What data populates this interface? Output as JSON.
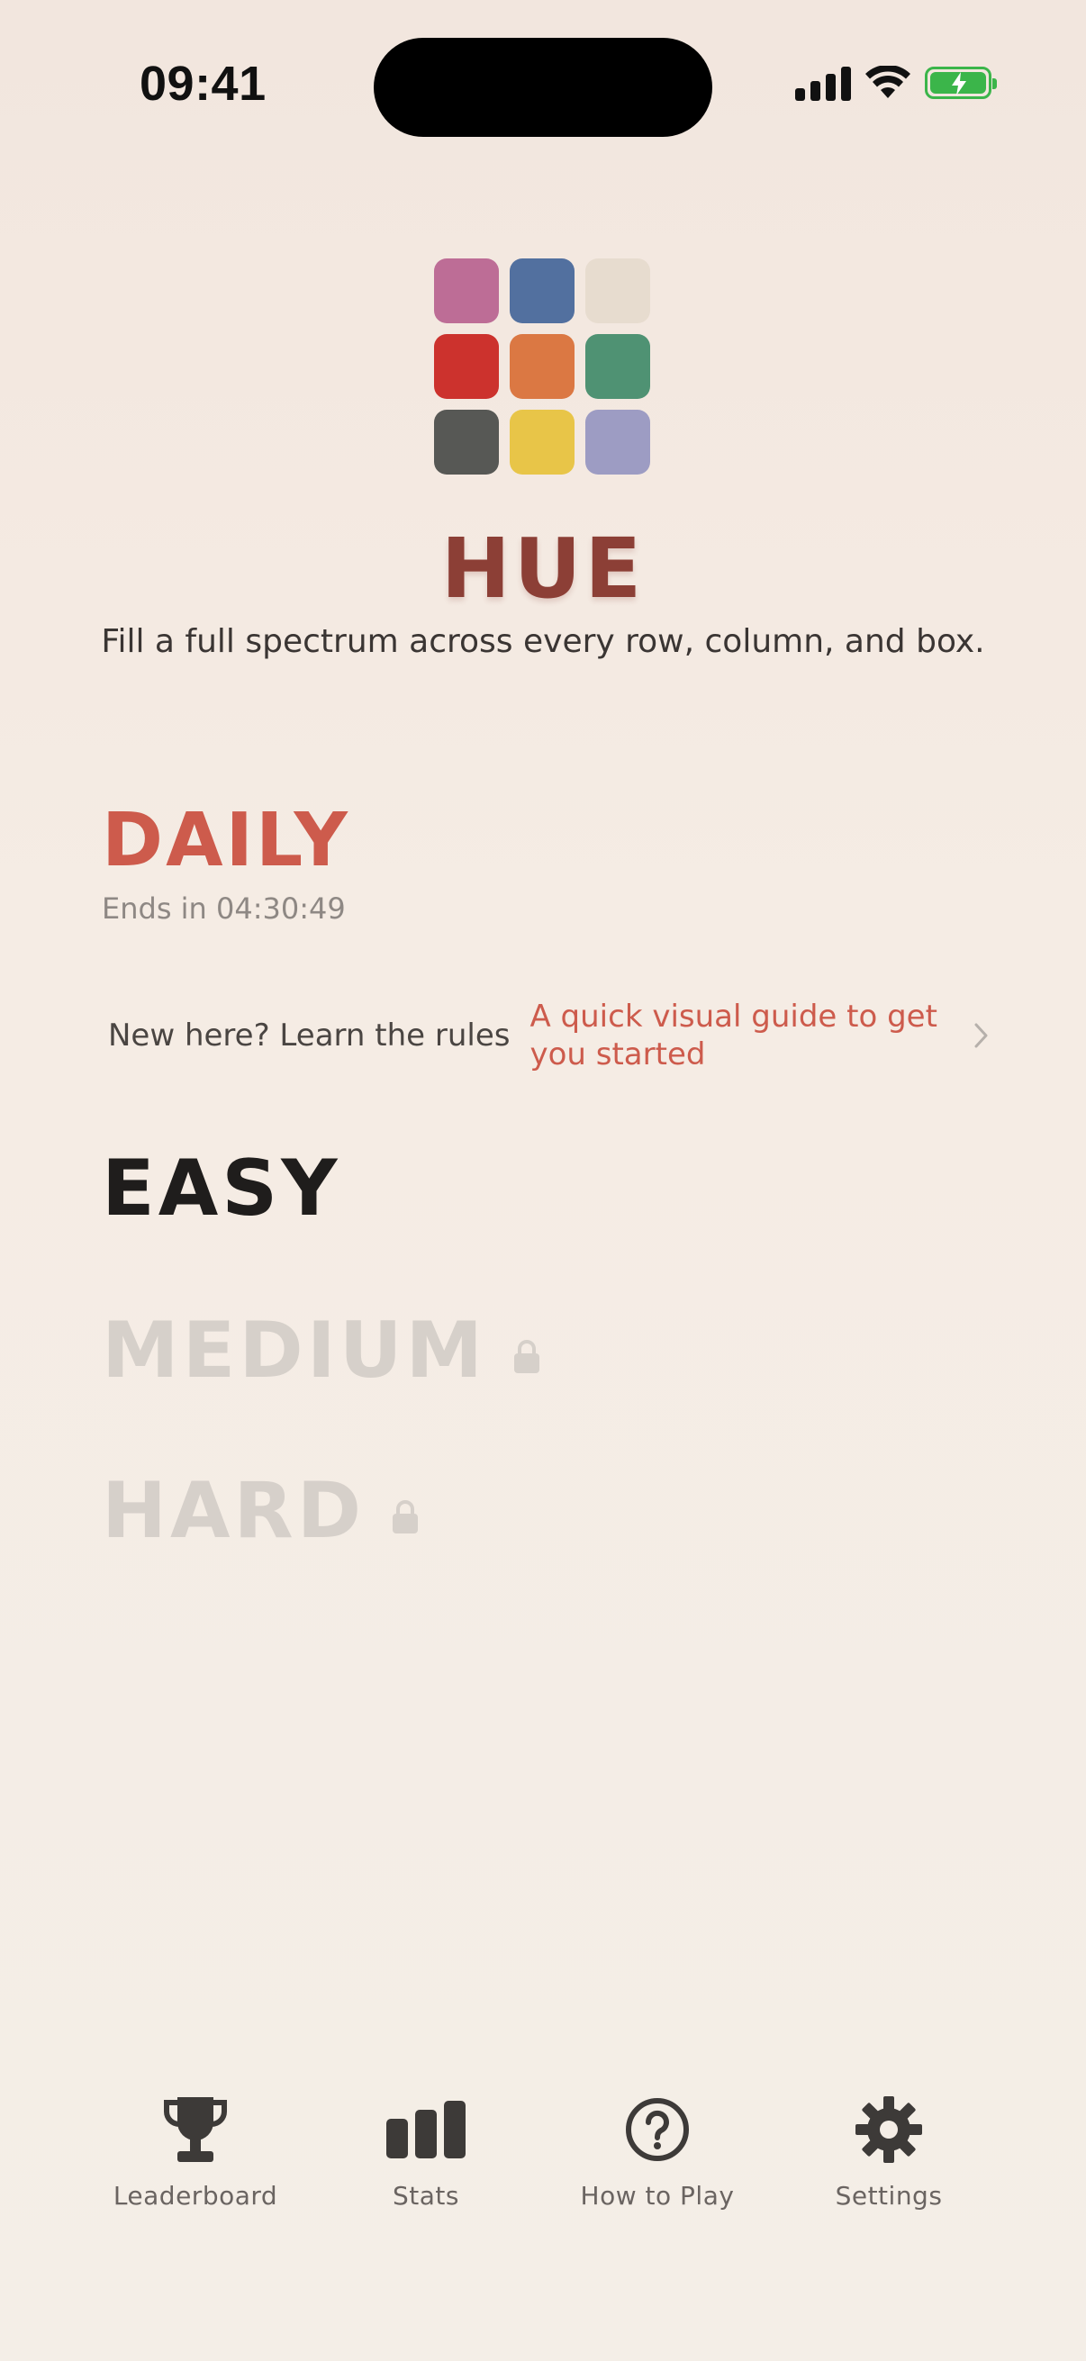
{
  "status_bar": {
    "time": "09:41"
  },
  "app": {
    "title": "HUE",
    "tagline": "Fill a full spectrum across every row, column, and box.",
    "logo_colors": [
      "#bd6d96",
      "#52709f",
      "#e7dccf",
      "#cc322d",
      "#db7843",
      "#4f9273",
      "#575855",
      "#e8c548",
      "#9d9cc3"
    ]
  },
  "daily": {
    "title": "DAILY",
    "timer": "Ends in 04:30:49"
  },
  "rules": {
    "label": "New here? Learn the rules",
    "guide": "A quick visual guide to get you started"
  },
  "difficulties": [
    {
      "label": "EASY",
      "locked": false
    },
    {
      "label": "MEDIUM",
      "locked": true
    },
    {
      "label": "HARD",
      "locked": true
    }
  ],
  "bottom_nav": [
    {
      "label": "Leaderboard",
      "icon": "trophy-icon"
    },
    {
      "label": "Stats",
      "icon": "bar-chart-icon"
    },
    {
      "label": "How to Play",
      "icon": "question-icon"
    },
    {
      "label": "Settings",
      "icon": "gear-icon"
    }
  ],
  "colors": {
    "accent": "#cd5b4c",
    "title": "#8c3f36",
    "locked": "#d6d0ca",
    "nav_icon": "#3d3a38"
  }
}
